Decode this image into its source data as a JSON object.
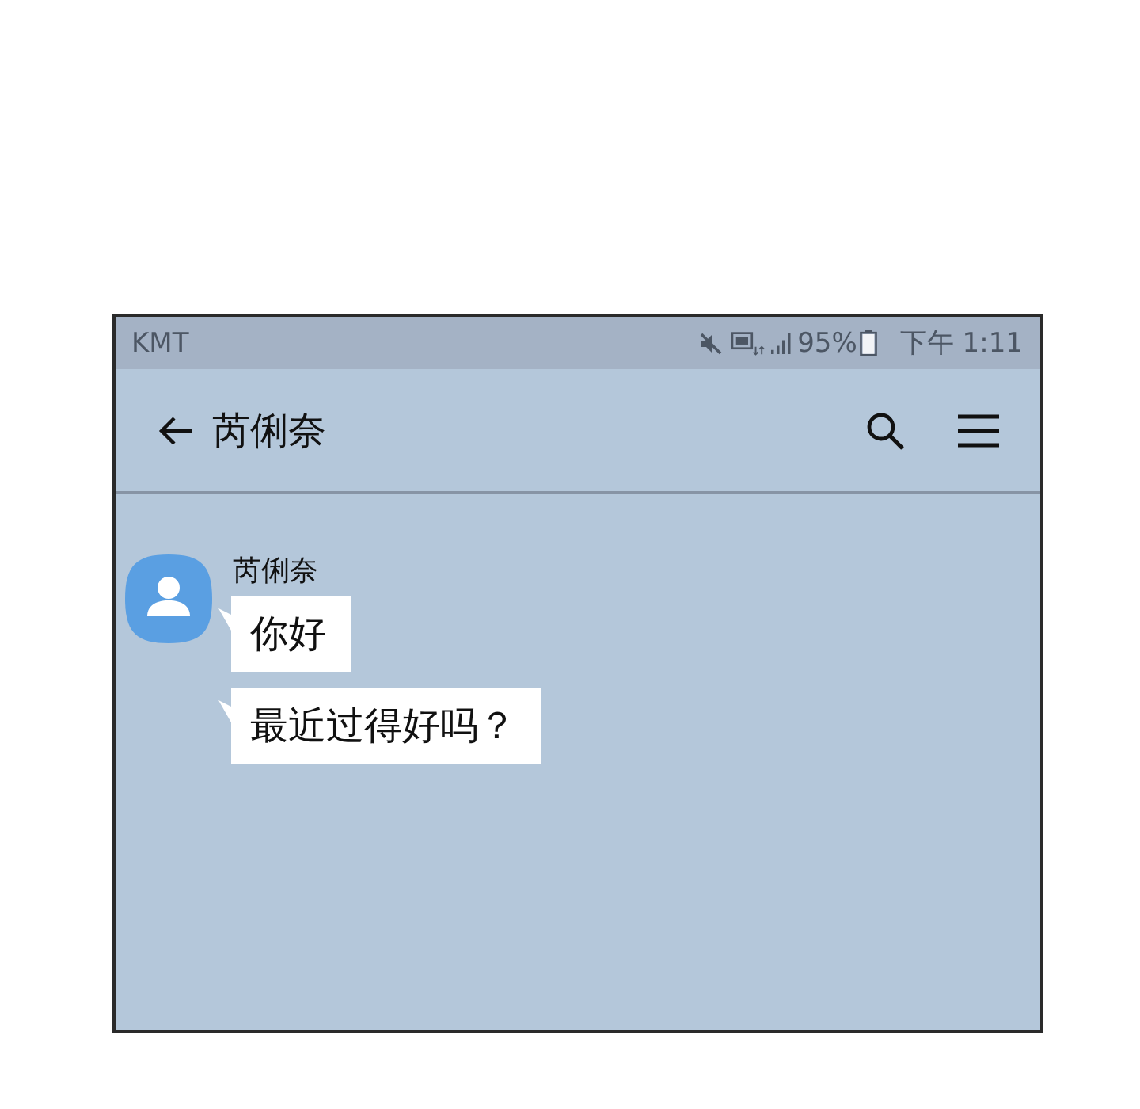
{
  "status_bar": {
    "carrier": "KMT",
    "battery": "95%",
    "time": "下午 1:11"
  },
  "header": {
    "title": "芮俐奈"
  },
  "conversation": {
    "sender": "芮俐奈",
    "messages": [
      {
        "text": "你好"
      },
      {
        "text": "最近过得好吗？"
      }
    ]
  }
}
